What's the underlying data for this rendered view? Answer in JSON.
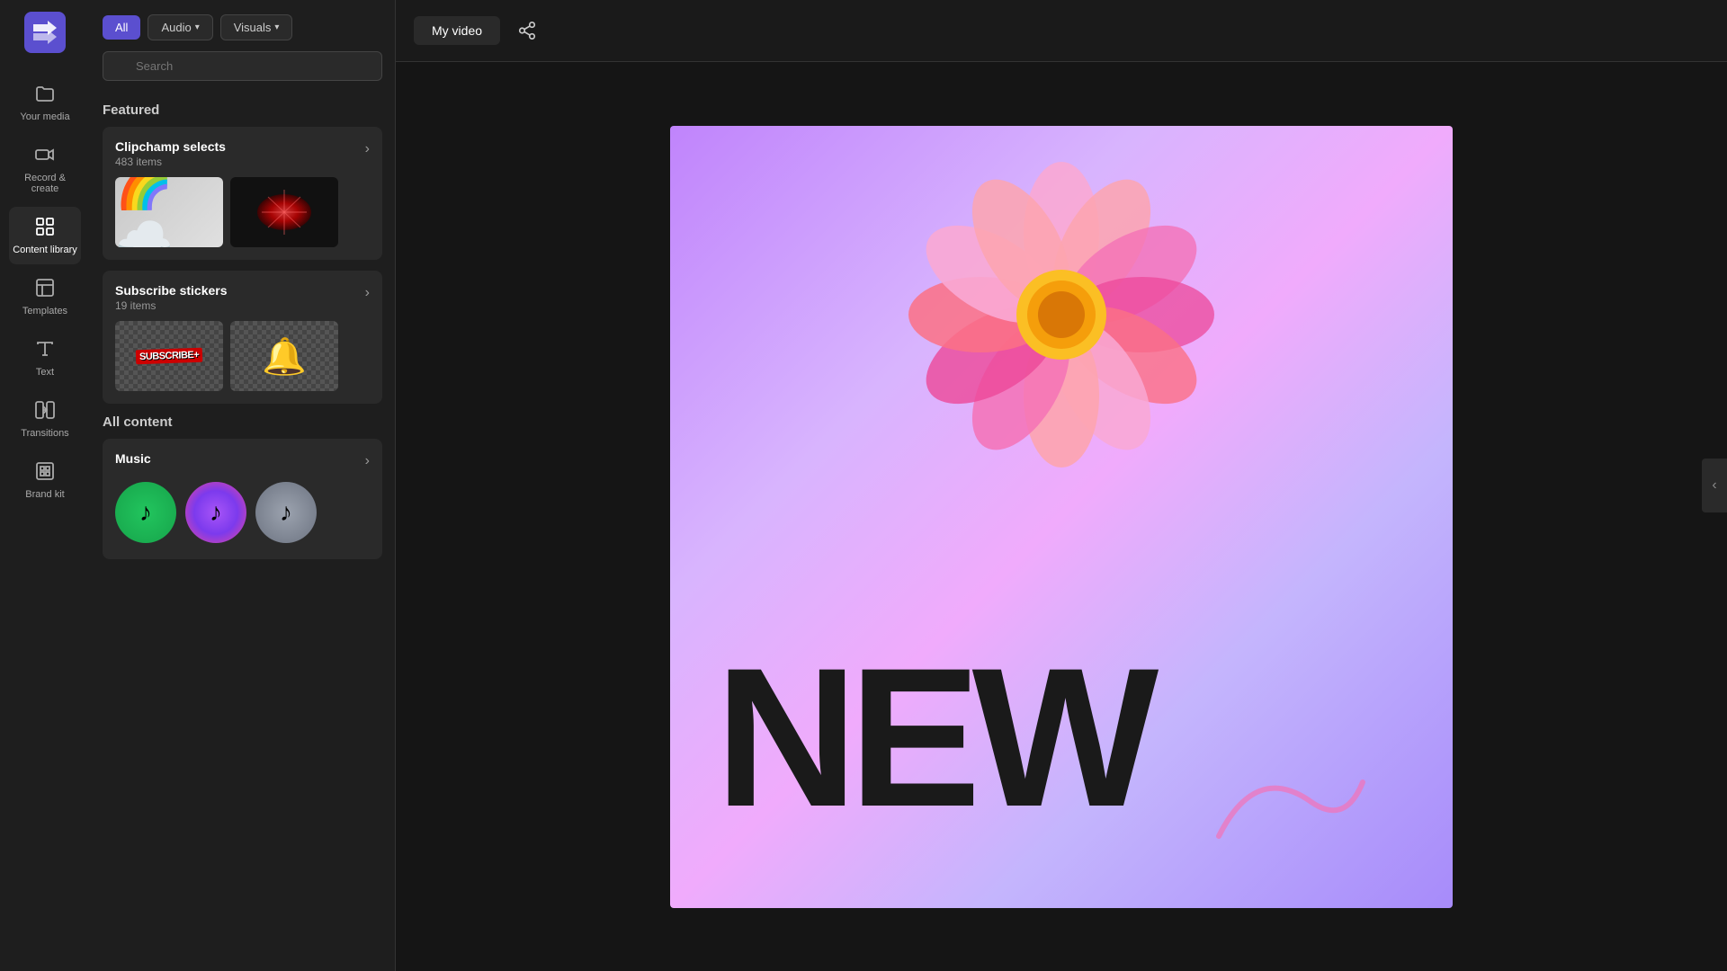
{
  "app": {
    "title": "Clipchamp"
  },
  "filters": {
    "all_label": "All",
    "audio_label": "Audio",
    "visuals_label": "Visuals"
  },
  "search": {
    "placeholder": "Search"
  },
  "sidebar": {
    "items": [
      {
        "id": "your-media",
        "label": "Your media",
        "icon": "folder"
      },
      {
        "id": "record-create",
        "label": "Record &\ncreate",
        "icon": "video-camera"
      },
      {
        "id": "content-library",
        "label": "Content library",
        "icon": "grid-2x2"
      },
      {
        "id": "templates",
        "label": "Templates",
        "icon": "layout"
      },
      {
        "id": "text",
        "label": "Text",
        "icon": "text-T"
      },
      {
        "id": "transitions",
        "label": "Transitions",
        "icon": "arrows-cross"
      },
      {
        "id": "brand-kit",
        "label": "Brand kit",
        "icon": "tag-brand"
      }
    ]
  },
  "featured": {
    "section_label": "Featured",
    "cards": [
      {
        "id": "clipchamp-selects",
        "title": "Clipchamp selects",
        "count": "483 items",
        "thumbs": [
          "rainbow-clouds",
          "dark-sparkle"
        ]
      },
      {
        "id": "subscribe-stickers",
        "title": "Subscribe stickers",
        "count": "19 items",
        "thumbs": [
          "subscribe-text",
          "colorful-bells"
        ]
      }
    ]
  },
  "all_content": {
    "section_label": "All content",
    "cards": [
      {
        "id": "music",
        "title": "Music",
        "thumbs": [
          "music-green",
          "music-purple",
          "music-gray"
        ]
      }
    ]
  },
  "video": {
    "title": "My video",
    "preview_text": "NEW"
  },
  "scroll_chevron": "‹"
}
